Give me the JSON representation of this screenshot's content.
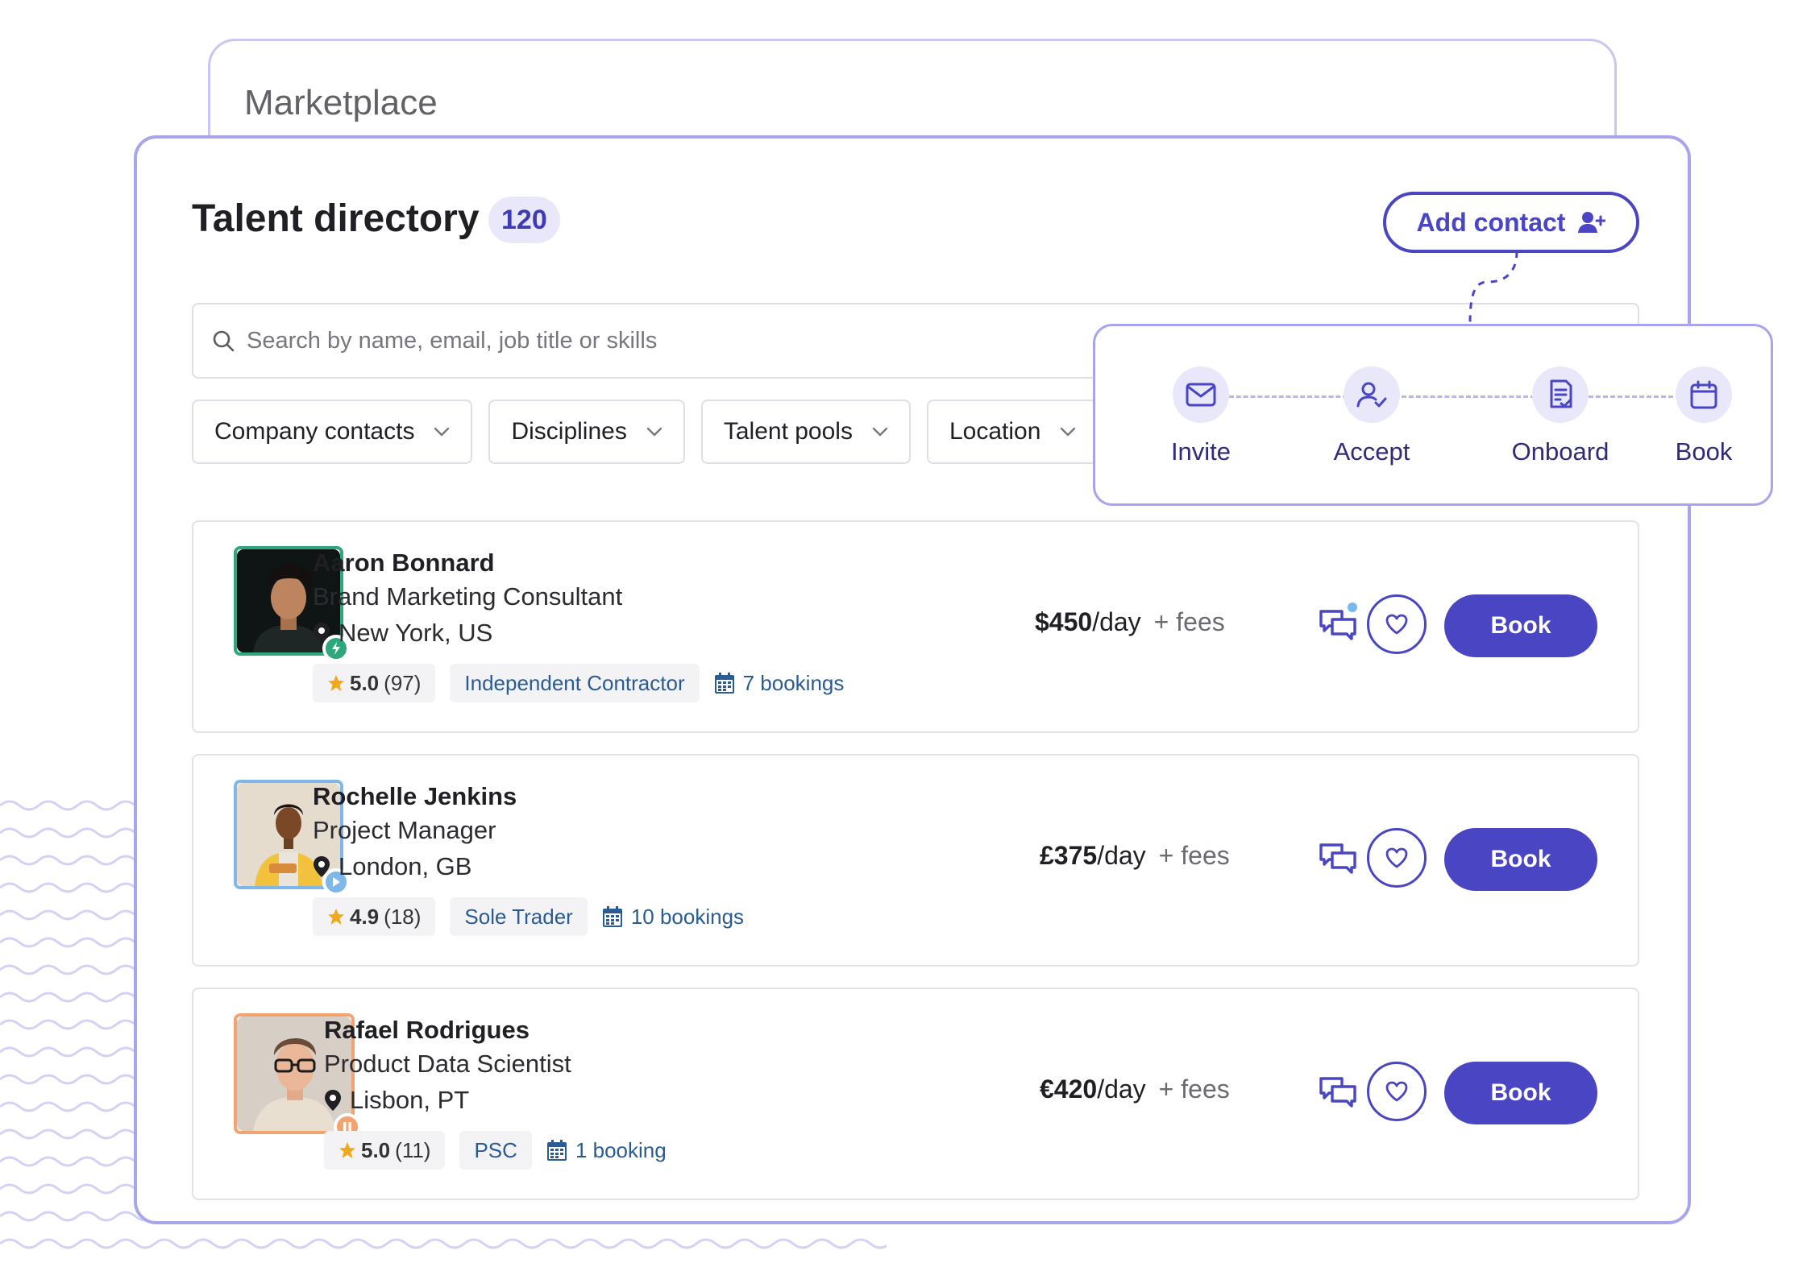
{
  "back_card": {
    "title": "Marketplace"
  },
  "header": {
    "title": "Talent directory",
    "count": "120",
    "add_contact_label": "Add contact"
  },
  "search": {
    "placeholder": "Search by name, email, job title or skills"
  },
  "filters": [
    {
      "label": "Company contacts"
    },
    {
      "label": "Disciplines"
    },
    {
      "label": "Talent pools"
    },
    {
      "label": "Location"
    }
  ],
  "workflow": {
    "steps": [
      {
        "label": "Invite",
        "icon": "mail-icon"
      },
      {
        "label": "Accept",
        "icon": "user-check-icon"
      },
      {
        "label": "Onboard",
        "icon": "document-check-icon"
      },
      {
        "label": "Book",
        "icon": "calendar-icon"
      }
    ]
  },
  "talent": [
    {
      "name": "Aaron Bonnard",
      "role": "Brand Marketing Consultant",
      "location": "New York, US",
      "rating": "5.0",
      "reviews": "(97)",
      "type": "Independent Contractor",
      "bookings": "7 bookings",
      "price": "$450",
      "unit": "/day",
      "fees": "+ fees",
      "book_label": "Book",
      "status_color": "#2fa77c",
      "status_icon": "bolt-icon",
      "unread": true
    },
    {
      "name": "Rochelle Jenkins",
      "role": "Project Manager",
      "location": "London, GB",
      "rating": "4.9",
      "reviews": "(18)",
      "type": "Sole Trader",
      "bookings": "10 bookings",
      "price": "£375",
      "unit": "/day",
      "fees": "+ fees",
      "book_label": "Book",
      "status_color": "#7fb8e8",
      "status_icon": "play-icon",
      "unread": false
    },
    {
      "name": "Rafael Rodrigues",
      "role": "Product Data Scientist",
      "location": "Lisbon, PT",
      "rating": "5.0",
      "reviews": "(11)",
      "type": "PSC",
      "bookings": "1 booking",
      "price": "€420",
      "unit": "/day",
      "fees": "+ fees",
      "book_label": "Book",
      "status_color": "#f2a36f",
      "status_icon": "pause-icon",
      "unread": false
    }
  ],
  "colors": {
    "accent": "#4a45c3",
    "accent_light": "#e9e8fb",
    "border": "#a9a5ec"
  }
}
